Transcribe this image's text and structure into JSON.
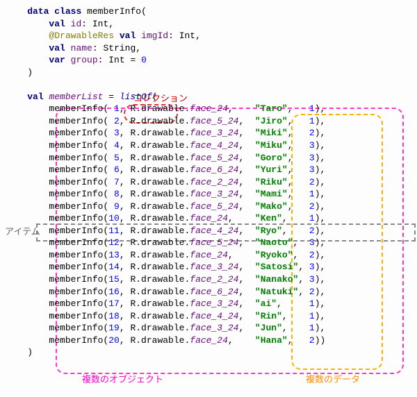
{
  "class_decl": {
    "kw_data": "data",
    "kw_class": "class",
    "name": "memberInfo",
    "fields": [
      {
        "kw": "val",
        "name": "id",
        "type": "Int"
      },
      {
        "ann": "@DrawableRes",
        "kw": "val",
        "name": "imgId",
        "type": "Int"
      },
      {
        "kw": "val",
        "name": "name",
        "type": "String"
      },
      {
        "kw": "var",
        "name": "group",
        "type": "Int",
        "default": "0"
      }
    ]
  },
  "list_decl": {
    "kw": "val",
    "name": "memberList",
    "fn": "listOf"
  },
  "rows": [
    {
      "id": "1",
      "face": "face_24",
      "pad": "   ",
      "name_": "Taro",
      "spad": "  ",
      "g": "1"
    },
    {
      "id": "2",
      "face": "face_5_24",
      "pad": " ",
      "name_": "Jiro",
      "spad": "  ",
      "g": "1"
    },
    {
      "id": "3",
      "face": "face_3_24",
      "pad": " ",
      "name_": "Miki",
      "spad": "  ",
      "g": "2"
    },
    {
      "id": "4",
      "face": "face_4_24",
      "pad": " ",
      "name_": "Miku",
      "spad": "  ",
      "g": "3"
    },
    {
      "id": "5",
      "face": "face_5_24",
      "pad": " ",
      "name_": "Goro",
      "spad": "  ",
      "g": "3"
    },
    {
      "id": "6",
      "face": "face_6_24",
      "pad": " ",
      "name_": "Yuri",
      "spad": "  ",
      "g": "3"
    },
    {
      "id": "7",
      "face": "face_2_24",
      "pad": " ",
      "name_": "Riku",
      "spad": "  ",
      "g": "2"
    },
    {
      "id": "8",
      "face": "face_3_24",
      "pad": " ",
      "name_": "Mami",
      "spad": "  ",
      "g": "1"
    },
    {
      "id": "9",
      "face": "face_5_24",
      "pad": " ",
      "name_": "Mako",
      "spad": "  ",
      "g": "2"
    },
    {
      "id": "10",
      "face": "face_24",
      "pad": "   ",
      "name_": "Ken",
      "spad": "   ",
      "g": "1"
    },
    {
      "id": "11",
      "face": "face_4_24",
      "pad": " ",
      "name_": "Ryo",
      "spad": "   ",
      "g": "2"
    },
    {
      "id": "12",
      "face": "face_5_24",
      "pad": " ",
      "name_": "Naoto",
      "spad": " ",
      "g": "3"
    },
    {
      "id": "13",
      "face": "face_24",
      "pad": "   ",
      "name_": "Ryoko",
      "spad": " ",
      "g": "2"
    },
    {
      "id": "14",
      "face": "face_3_24",
      "pad": " ",
      "name_": "Satosi",
      "spad": "",
      "g": "3"
    },
    {
      "id": "15",
      "face": "face_2_24",
      "pad": " ",
      "name_": "Nanako",
      "spad": "",
      "g": "3"
    },
    {
      "id": "16",
      "face": "face_6_24",
      "pad": " ",
      "name_": "Natuki",
      "spad": "",
      "g": "2"
    },
    {
      "id": "17",
      "face": "face_3_24",
      "pad": " ",
      "name_": "ai",
      "spad": "    ",
      "g": "1"
    },
    {
      "id": "18",
      "face": "face_4_24",
      "pad": " ",
      "name_": "Rin",
      "spad": "   ",
      "g": "1"
    },
    {
      "id": "19",
      "face": "face_3_24",
      "pad": " ",
      "name_": "Jun",
      "spad": "   ",
      "g": "1"
    },
    {
      "id": "20",
      "face": "face_24",
      "pad": "   ",
      "name_": "Hana",
      "spad": "  ",
      "g": "2"
    }
  ],
  "labels": {
    "collection": "コレクション",
    "item": "アイテム",
    "objects": "複数のオブジェクト",
    "data": "複数のデータ"
  }
}
